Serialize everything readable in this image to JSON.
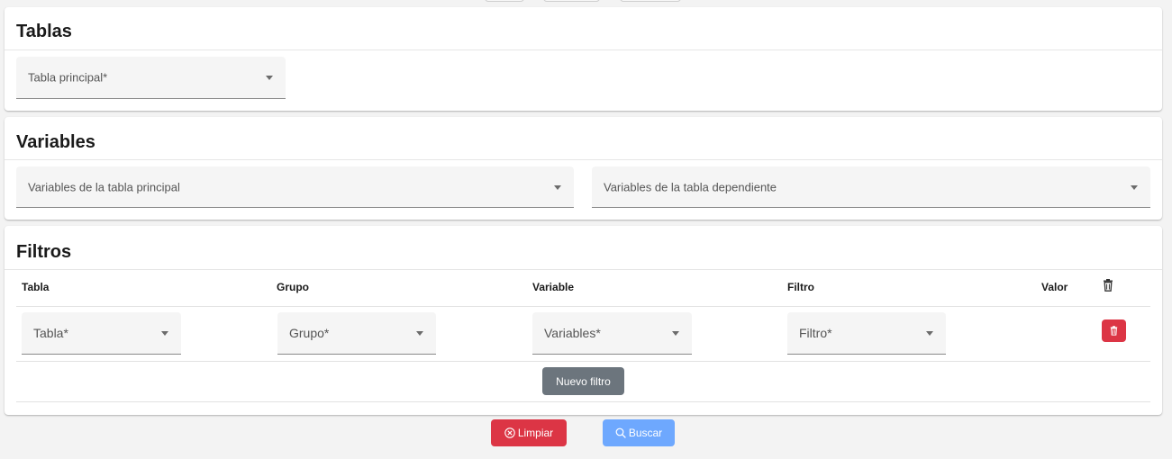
{
  "tablas": {
    "title": "Tablas",
    "tabla_principal_label": "Tabla principal*"
  },
  "variables": {
    "title": "Variables",
    "principal_label": "Variables de la tabla principal",
    "dependiente_label": "Variables de la tabla dependiente"
  },
  "filtros": {
    "title": "Filtros",
    "columns": {
      "tabla": "Tabla",
      "grupo": "Grupo",
      "variable": "Variable",
      "filtro": "Filtro",
      "valor": "Valor"
    },
    "header_icon": "trash-icon",
    "row": {
      "tabla_label": "Tabla*",
      "grupo_label": "Grupo*",
      "variables_label": "Variables*",
      "filtro_label": "Filtro*",
      "delete_icon": "trash-icon"
    },
    "nuevo_filtro_label": "Nuevo filtro"
  },
  "actions": {
    "limpiar_label": "Limpiar",
    "limpiar_icon": "x-circle-icon",
    "buscar_label": "Buscar",
    "buscar_icon": "search-icon"
  },
  "colors": {
    "danger": "#dc3545",
    "primary": "#6ea8fe",
    "secondary": "#6c757d",
    "field_bg": "#f5f5f5"
  }
}
